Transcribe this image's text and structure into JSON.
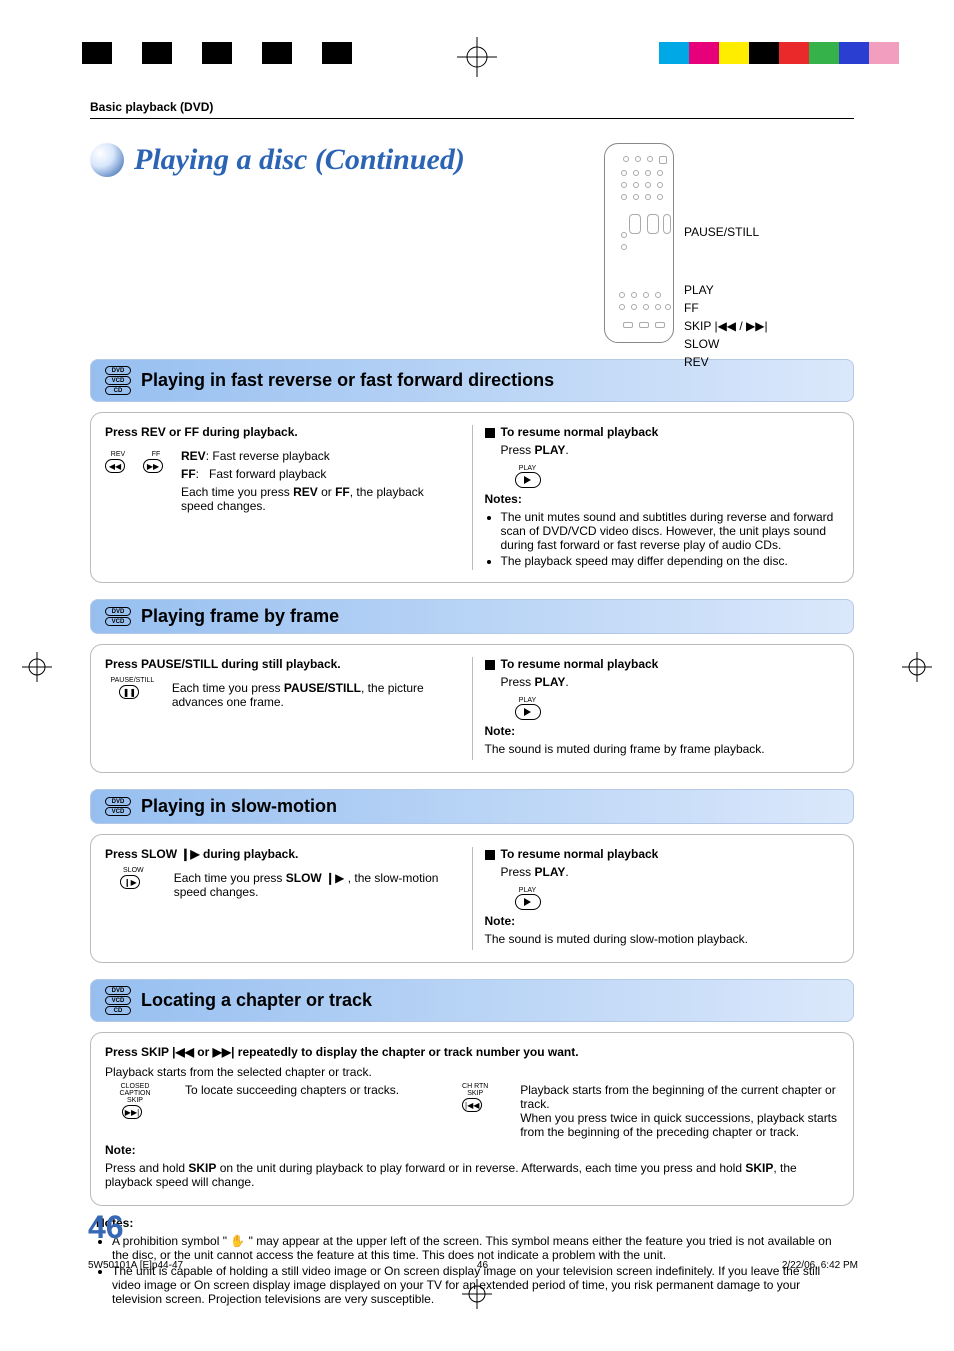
{
  "header": {
    "breadcrumb": "Basic playback (DVD)"
  },
  "title": "Playing a disc (Continued)",
  "remote_labels": {
    "pause": "PAUSE/STILL",
    "play": "PLAY",
    "ff": "FF",
    "skip": "SKIP |◀◀ / ▶▶|",
    "slow": "SLOW",
    "rev": "REV"
  },
  "sections": {
    "ffrev": {
      "title": "Playing in fast reverse or fast forward directions",
      "discs": [
        "DVD",
        "VCD",
        "CD"
      ],
      "left": {
        "head": "Press REV or FF during playback.",
        "rev_label": "REV",
        "rev_desc": "Fast reverse playback",
        "ff_label": "FF",
        "ff_desc": "Fast forward playback",
        "body1a": "Each time you press ",
        "body1b": "REV",
        "body1c": " or ",
        "body1d": "FF",
        "body1e": ", the playback speed changes.",
        "icon_rev": "REV",
        "icon_ff": "FF"
      },
      "right": {
        "resume_head": "To resume normal playback",
        "resume_a": "Press ",
        "resume_b": "PLAY",
        "resume_c": ".",
        "play_icon_label": "PLAY",
        "notes_head": "Notes:",
        "note1": "The unit mutes sound and subtitles during reverse and forward scan of DVD/VCD video discs. However, the unit plays sound during fast forward or fast reverse play of audio CDs.",
        "note2": "The playback speed may differ depending on the disc."
      }
    },
    "frame": {
      "title": "Playing frame by frame",
      "discs": [
        "DVD",
        "VCD"
      ],
      "left": {
        "head": "Press PAUSE/STILL during still playback.",
        "body_a": "Each time you press ",
        "body_b": "PAUSE/STILL",
        "body_c": ", the picture advances one frame.",
        "icon_label": "PAUSE/STILL"
      },
      "right": {
        "resume_head": "To resume normal playback",
        "resume_a": "Press ",
        "resume_b": "PLAY",
        "resume_c": ".",
        "play_icon_label": "PLAY",
        "note_head": "Note:",
        "note": "The sound is muted during frame by frame playback."
      }
    },
    "slow": {
      "title": "Playing in slow-motion",
      "discs": [
        "DVD",
        "VCD"
      ],
      "left": {
        "head_a": "Press SLOW ",
        "head_b": " during playback.",
        "body_a": "Each time you press ",
        "body_b": "SLOW",
        "body_c": " , the slow-motion speed changes.",
        "icon_label": "SLOW"
      },
      "right": {
        "resume_head": "To resume normal playback",
        "resume_a": "Press ",
        "resume_b": "PLAY",
        "resume_c": ".",
        "play_icon_label": "PLAY",
        "note_head": "Note:",
        "note": "The sound is muted during slow-motion playback."
      }
    },
    "locate": {
      "title": "Locating a chapter or track",
      "discs": [
        "DVD",
        "VCD",
        "CD"
      ],
      "head": "Press SKIP |◀◀ or ▶▶| repeatedly to display the chapter or track number you want.",
      "sub": "Playback starts from the selected chapter or track.",
      "left_icon_top": "CLOSED CAPTION",
      "left_icon_mid": "SKIP",
      "left_text": "To locate succeeding chapters or tracks.",
      "right_icon_top": "CH RTN",
      "right_icon_mid": "SKIP",
      "right_text": "Playback starts from the beginning of the current chapter or track.\nWhen you press twice in quick successions, playback starts from the beginning of the preceding chapter or track.",
      "note_head": "Note:",
      "note_a": "Press and hold ",
      "note_b": "SKIP",
      "note_c": " on the unit during playback to play forward or in reverse. Afterwards, each time you press and hold ",
      "note_d": "SKIP",
      "note_e": ", the playback speed will change."
    }
  },
  "global_notes": {
    "head": "Notes:",
    "n1": "A prohibition symbol \" ✋ \" may appear at the upper left of the screen. This symbol means either the feature you tried is not available on the disc, or the unit cannot access the feature at this time. This does not indicate a problem with the unit.",
    "n2": "The unit is capable of holding a still video image or On screen display image on your television screen indefinitely. If you leave the still video image or On screen display image displayed on your TV for an extended period of time, you risk permanent damage to your television screen. Projection televisions are very susceptible."
  },
  "page_number": "46",
  "footer": {
    "file": "5W50101A [E]p44-47",
    "page": "46",
    "date": "2/22/06, 6:42 PM"
  },
  "colors": {
    "accent": "#2b64b5",
    "bar_grad_from": "#96bff0",
    "bar_grad_to": "#dbe8fb"
  },
  "printer_colors": [
    "#00a9e6",
    "#e6007a",
    "#ffed00",
    "#000000",
    "#ea2a2a",
    "#36b24a",
    "#2a3fd1",
    "#f29fbf"
  ]
}
